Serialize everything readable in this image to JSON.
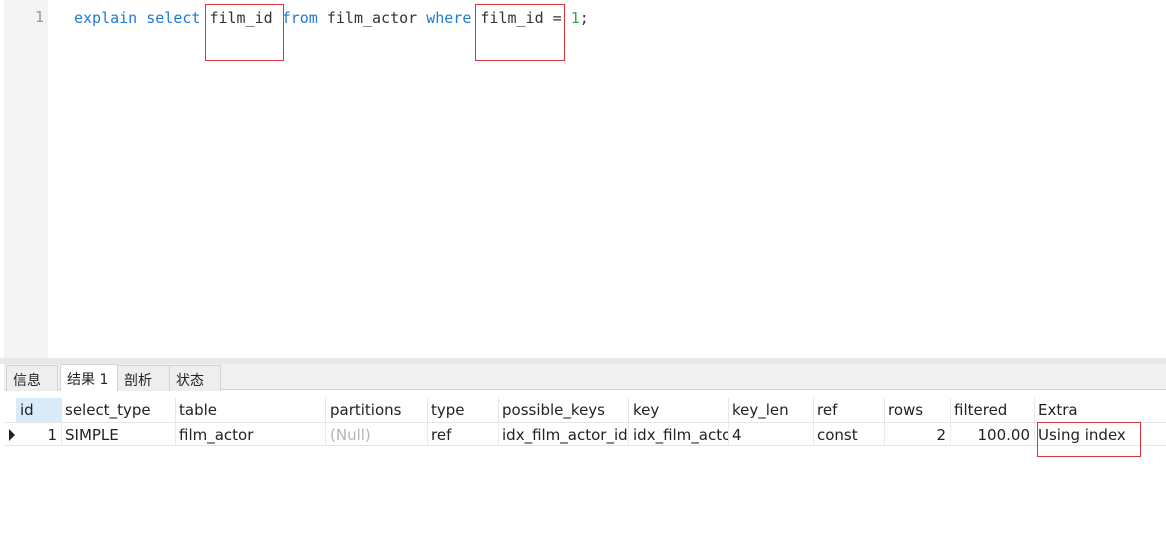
{
  "editor": {
    "line_number": "1",
    "tokens": {
      "t1": "explain",
      "t2": "select",
      "t3": "film_id",
      "t4": "from",
      "t5": "film_actor",
      "t6": "where",
      "t7": "film_id",
      "t8": "=",
      "t9": "1",
      "t10": ";"
    }
  },
  "tabs": [
    {
      "label": "信息"
    },
    {
      "label": "结果 1"
    },
    {
      "label": "剖析"
    },
    {
      "label": "状态"
    }
  ],
  "active_tab": "结果 1",
  "grid": {
    "columns": [
      "id",
      "select_type",
      "table",
      "partitions",
      "type",
      "possible_keys",
      "key",
      "key_len",
      "ref",
      "rows",
      "filtered",
      "Extra"
    ],
    "rows": [
      [
        "1",
        "SIMPLE",
        "film_actor",
        "(Null)",
        "ref",
        "idx_film_actor_id",
        "idx_film_acto",
        "4",
        "const",
        "2",
        "100.00",
        "Using index"
      ]
    ]
  },
  "colors": {
    "keyword": "#1e7ad4",
    "number": "#2fa84a",
    "highlight_box": "#d8363b",
    "selected_header": "#d9eaf8"
  }
}
